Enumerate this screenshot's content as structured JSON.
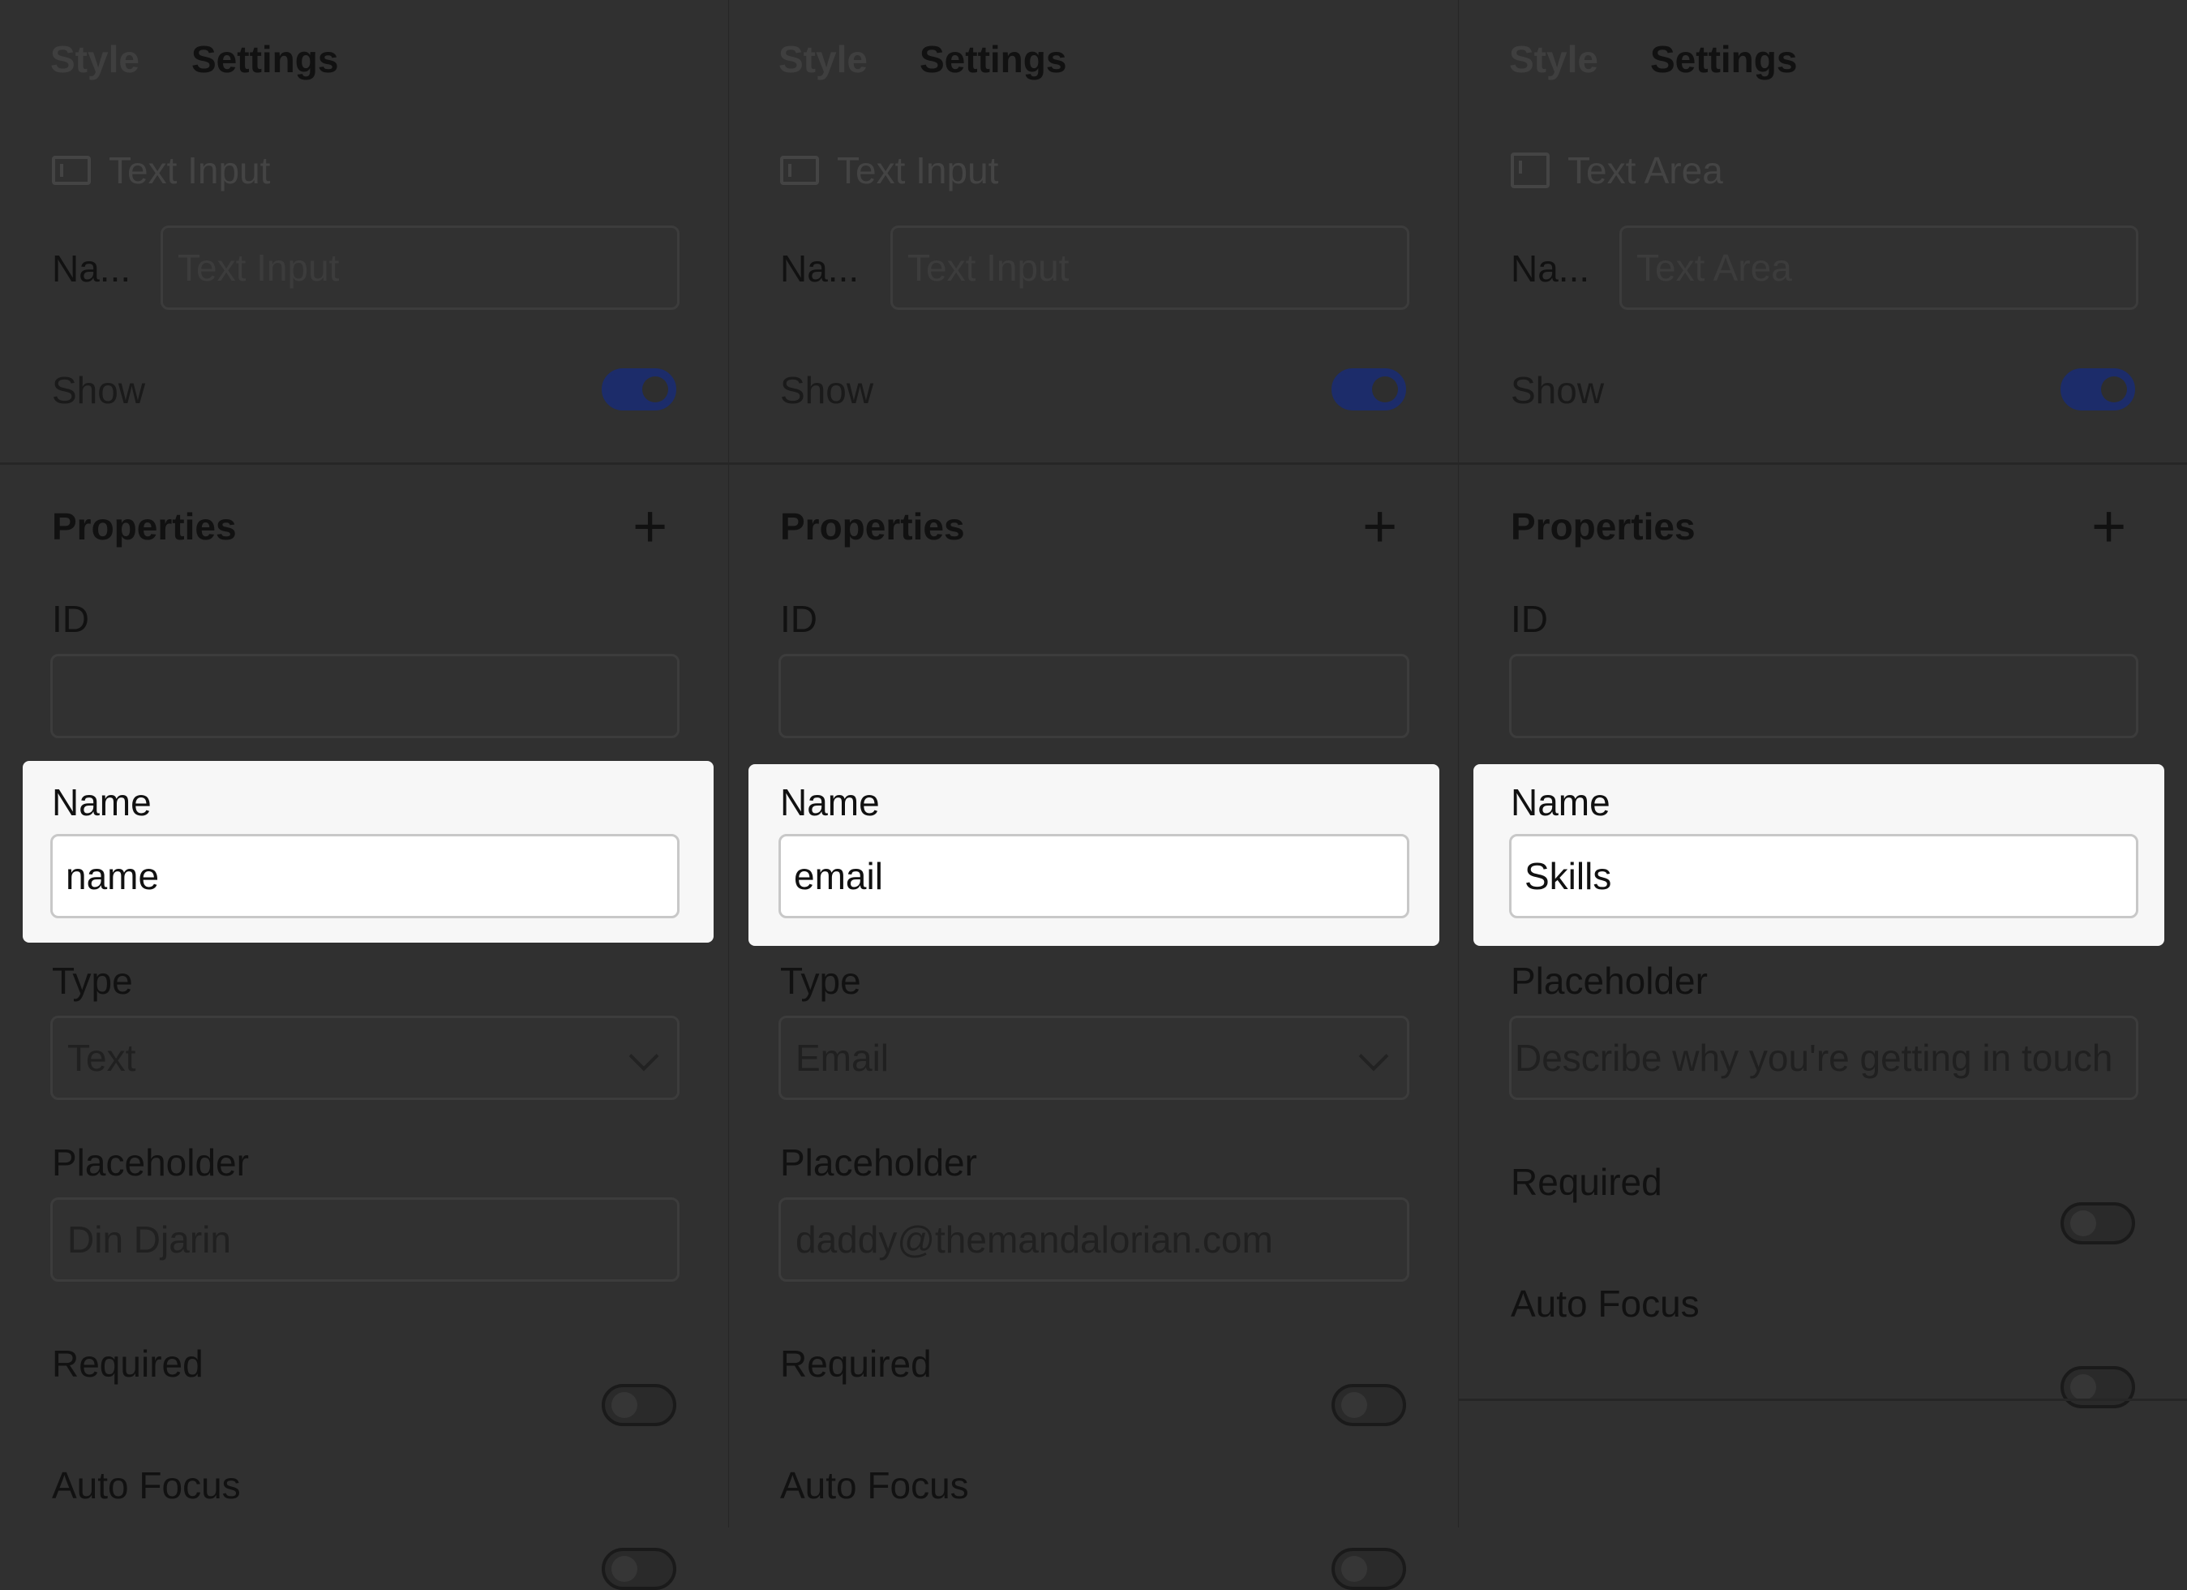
{
  "panels": [
    {
      "tabs": {
        "style": "Style",
        "settings": "Settings"
      },
      "element_type": "Text Input",
      "name_short": "Na...",
      "name_field_value": "Text Input",
      "show_label": "Show",
      "show_on": true,
      "properties_label": "Properties",
      "id_label": "ID",
      "id_value": "",
      "name_label": "Name",
      "name_value": "name",
      "type_label": "Type",
      "type_value": "Text",
      "placeholder_label": "Placeholder",
      "placeholder_value": "Din Djarin",
      "required_label": "Required",
      "required_on": false,
      "autofocus_label": "Auto Focus",
      "autofocus_on": false
    },
    {
      "tabs": {
        "style": "Style",
        "settings": "Settings"
      },
      "element_type": "Text Input",
      "name_short": "Na...",
      "name_field_value": "Text Input",
      "show_label": "Show",
      "show_on": true,
      "properties_label": "Properties",
      "id_label": "ID",
      "id_value": "",
      "name_label": "Name",
      "name_value": "email",
      "type_label": "Type",
      "type_value": "Email",
      "placeholder_label": "Placeholder",
      "placeholder_value": "daddy@themandalorian.com",
      "required_label": "Required",
      "required_on": false,
      "autofocus_label": "Auto Focus",
      "autofocus_on": false
    },
    {
      "tabs": {
        "style": "Style",
        "settings": "Settings"
      },
      "element_type": "Text Area",
      "name_short": "Na...",
      "name_field_value": "Text Area",
      "show_label": "Show",
      "show_on": true,
      "properties_label": "Properties",
      "id_label": "ID",
      "id_value": "",
      "name_label": "Name",
      "name_value": "Skills",
      "placeholder_label": "Placeholder",
      "placeholder_value": "Describe why you're getting in touch",
      "required_label": "Required",
      "required_on": false,
      "autofocus_label": "Auto Focus",
      "autofocus_on": false
    }
  ],
  "colors": {
    "background": "#303030",
    "toggle_on": "#1c2c6a",
    "highlight": "#f7f7f7"
  }
}
